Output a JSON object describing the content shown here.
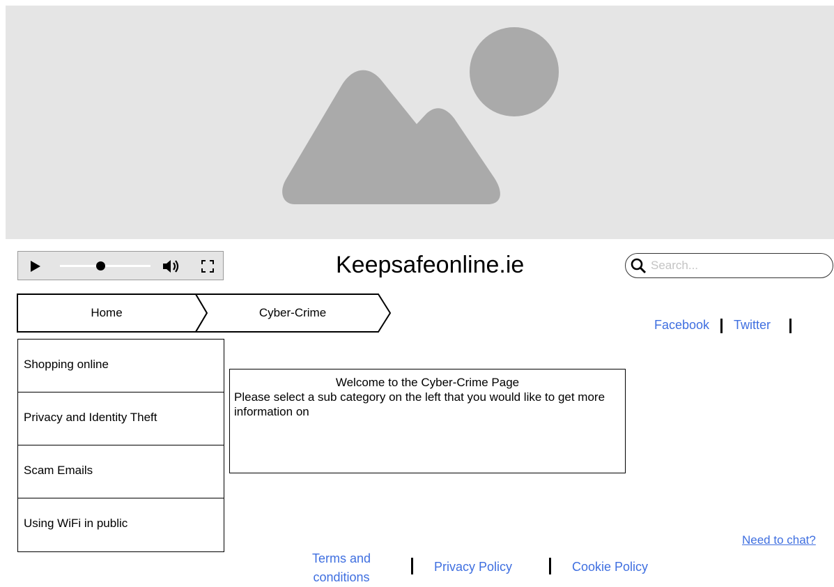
{
  "hero": {
    "image_icon": "image-placeholder-icon"
  },
  "player": {
    "play_icon": "play-icon",
    "volume_icon": "volume-icon",
    "fullscreen_icon": "fullscreen-icon",
    "progress": 0.45
  },
  "header": {
    "title": "Keepsafeonline.ie"
  },
  "search": {
    "placeholder": "Search...",
    "value": ""
  },
  "breadcrumb": [
    "Home",
    "Cyber-Crime"
  ],
  "social": {
    "facebook": "Facebook",
    "twitter": "Twitter"
  },
  "sidebar": {
    "items": [
      {
        "label": "Shopping online"
      },
      {
        "label": "Privacy and Identity Theft"
      },
      {
        "label": "Scam Emails"
      },
      {
        "label": "Using WiFi in public"
      }
    ]
  },
  "welcome": {
    "title": "Welcome to the Cyber-Crime Page",
    "body": "Please select a sub category on the left that you would like to get more information on"
  },
  "chat": {
    "label": "Need to chat?"
  },
  "footer": {
    "terms": "Terms and conditions",
    "privacy": "Privacy Policy",
    "cookie": "Cookie Policy"
  },
  "colors": {
    "link": "#3f6fe0",
    "placeholder_bg": "#e5e5e5",
    "placeholder_shape": "#aaaaaa"
  }
}
